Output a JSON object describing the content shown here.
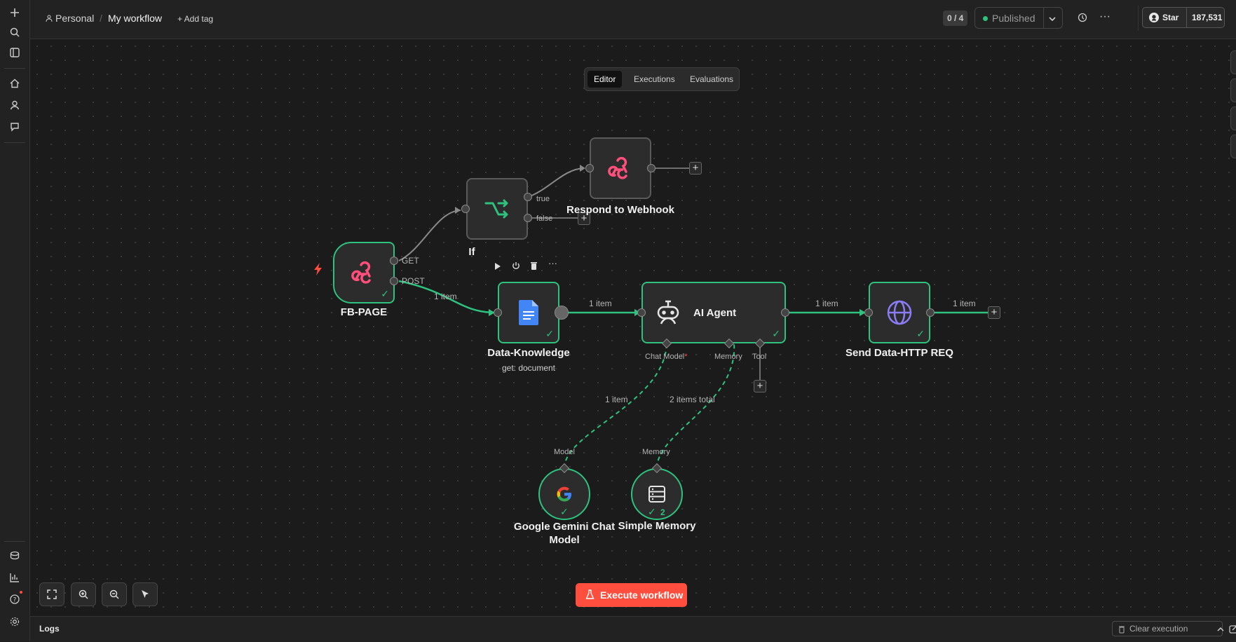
{
  "header": {
    "project": "Personal",
    "workflow_name": "My workflow",
    "add_tag": "+ Add tag",
    "counter": "0 / 4",
    "status": "Published",
    "github_star": "Star",
    "github_count": "187,531"
  },
  "tabs": [
    {
      "label": "Editor",
      "active": true
    },
    {
      "label": "Executions",
      "active": false
    },
    {
      "label": "Evaluations",
      "active": false
    }
  ],
  "nodes": {
    "fb_page": {
      "label": "FB-PAGE",
      "out_get": "GET",
      "out_post": "POST",
      "icon": "webhook-icon"
    },
    "if": {
      "label": "If",
      "out_true": "true",
      "out_false": "false",
      "icon": "if-branch-icon"
    },
    "respond": {
      "label": "Respond to Webhook",
      "icon": "webhook-icon"
    },
    "data_knowledge": {
      "label": "Data-Knowledge",
      "sub": "get: document",
      "icon": "google-docs-icon"
    },
    "ai_agent": {
      "label": "AI Agent",
      "port_chat": "Chat Model",
      "port_required": "*",
      "port_memory": "Memory",
      "port_tool": "Tool",
      "icon": "robot-icon"
    },
    "send_data": {
      "label": "Send Data-HTTP REQ",
      "icon": "globe-icon"
    },
    "gemini": {
      "label_line1": "Google Gemini Chat",
      "label_line2": "Model",
      "port": "Model",
      "icon": "google-icon"
    },
    "memory": {
      "label": "Simple Memory",
      "port": "Memory",
      "badge": "2",
      "icon": "database-icon"
    }
  },
  "edges": {
    "post_to_data": "1 item",
    "data_to_agent": "1 item",
    "agent_to_send": "1 item",
    "send_out": "1 item",
    "gemini_to_agent": "1 item",
    "memory_to_agent": "2 items total"
  },
  "execute_button": "Execute workflow",
  "footer": {
    "logs": "Logs",
    "clear": "Clear execution"
  },
  "colors": {
    "accent": "#ff4e3d",
    "success": "#2ec27e",
    "webhook": "#ff4f7a",
    "bg": "#1b1b1b"
  }
}
